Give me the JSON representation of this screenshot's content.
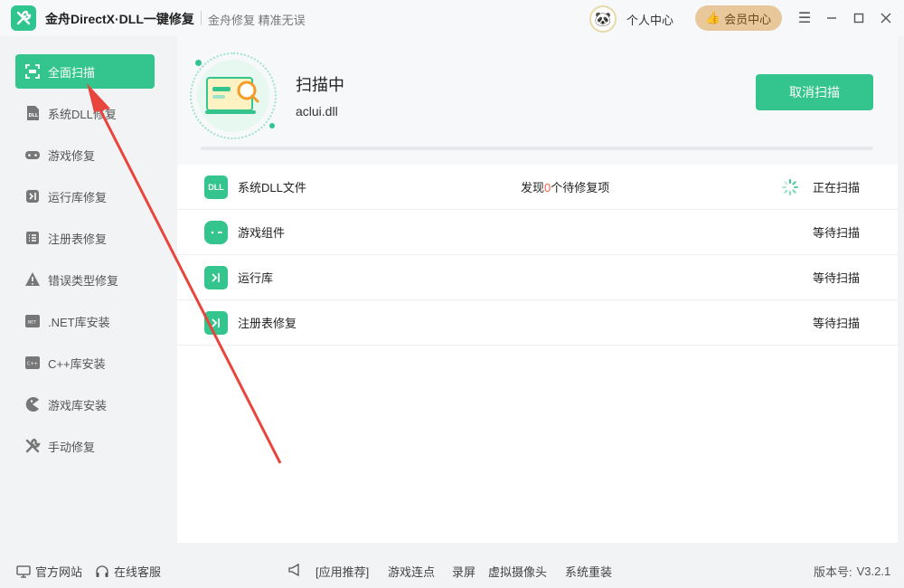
{
  "window": {
    "title": "金舟DirectX·DLL一键修复",
    "slogan": "金舟修复 精准无误",
    "user_center": "个人中心",
    "vip_label": "会员中心"
  },
  "sidebar": {
    "items": [
      {
        "label": "全面扫描",
        "icon": "scan-icon",
        "active": true
      },
      {
        "label": "系统DLL修复",
        "icon": "dll-icon"
      },
      {
        "label": "游戏修复",
        "icon": "gamepad-icon"
      },
      {
        "label": "运行库修复",
        "icon": "runtime-icon"
      },
      {
        "label": "注册表修复",
        "icon": "registry-icon"
      },
      {
        "label": "错误类型修复",
        "icon": "warning-icon"
      },
      {
        "label": ".NET库安装",
        "icon": "dotnet-icon"
      },
      {
        "label": "C++库安装",
        "icon": "cpp-icon"
      },
      {
        "label": "游戏库安装",
        "icon": "pacman-icon"
      },
      {
        "label": "手动修复",
        "icon": "wrench-icon"
      }
    ]
  },
  "scan": {
    "status": "扫描中",
    "current_file": "aclui.dll",
    "cancel_label": "取消扫描",
    "progress": 0.0
  },
  "rows": [
    {
      "name": "系统DLL文件",
      "icon_text": "DLL",
      "found_prefix": "发现",
      "found_count": "0",
      "found_suffix": "个待修复项",
      "status": "正在扫描"
    },
    {
      "name": "游戏组件",
      "icon_text": "",
      "status": "等待扫描"
    },
    {
      "name": "运行库",
      "icon_text": "",
      "status": "等待扫描"
    },
    {
      "name": "注册表修复",
      "icon_text": "",
      "status": "等待扫描"
    }
  ],
  "footer": {
    "website": "官方网站",
    "support": "在线客服",
    "recommend": "[应用推荐]",
    "links": [
      "游戏连点",
      "录屏",
      "虚拟摄像头",
      "系统重装"
    ],
    "version_label": "版本号:",
    "version": "V3.2.1"
  },
  "colors": {
    "accent": "#34c48e",
    "annotation": "#e8453c",
    "vip": "#e8c79a"
  }
}
